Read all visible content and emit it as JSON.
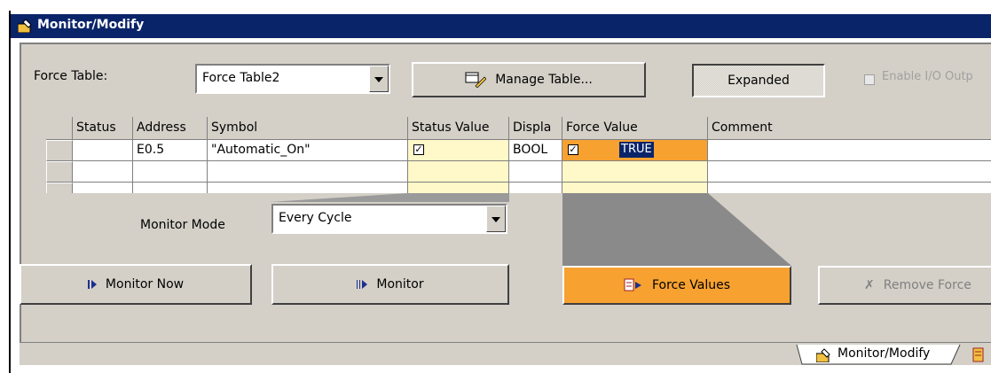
{
  "window": {
    "title": "Monitor/Modify"
  },
  "toolbar": {
    "force_table_label": "Force Table:",
    "force_table_value": "Force Table2",
    "manage_table_label": "Manage Table...",
    "expanded_label": "Expanded",
    "enable_io_label": "Enable I/O Outp"
  },
  "table": {
    "columns": [
      "",
      "Status",
      "Address",
      "Symbol",
      "Status Value",
      "Displa",
      "Force Value",
      "Comment"
    ],
    "rows": [
      {
        "status": "",
        "address": "E0.5",
        "symbol": "\"Automatic_On\"",
        "status_value_checked": true,
        "display": "BOOL",
        "force_value_checked": true,
        "force_value_text": "TRUE",
        "comment": ""
      },
      {
        "status": "",
        "address": "",
        "symbol": "",
        "status_value_checked": false,
        "display": "",
        "force_value_checked": false,
        "force_value_text": "",
        "comment": ""
      },
      {
        "status": "",
        "address": "",
        "symbol": "",
        "status_value_checked": false,
        "display": "",
        "force_value_checked": false,
        "force_value_text": "",
        "comment": ""
      }
    ]
  },
  "monitor": {
    "mode_label": "Monitor Mode",
    "mode_value": "Every Cycle"
  },
  "buttons": {
    "monitor_now": "Monitor Now",
    "monitor": "Monitor",
    "force_values": "Force Values",
    "remove_force": "Remove Force"
  },
  "tabs": {
    "active": "Monitor/Modify"
  },
  "colors": {
    "title_bar": "#0a246a",
    "highlight_orange": "#f7a130",
    "yellow_cell": "#fff8c8",
    "panel": "#d4d0c8"
  }
}
